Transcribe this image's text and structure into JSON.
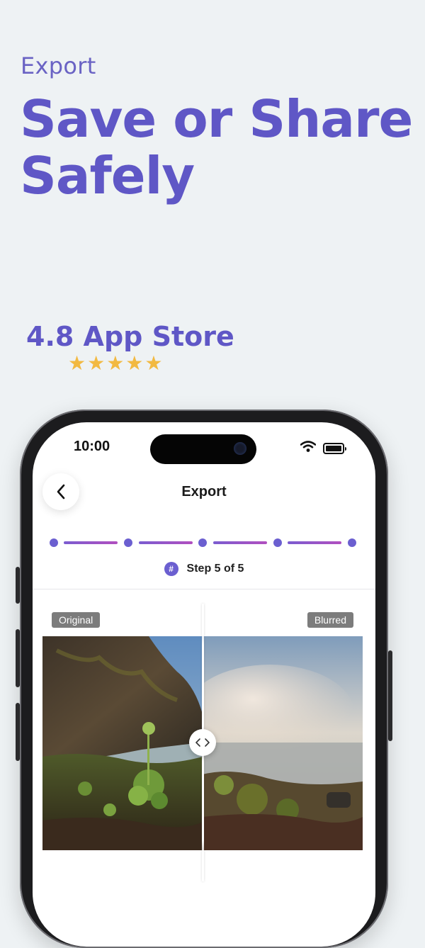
{
  "promo": {
    "eyebrow": "Export",
    "headline": "Save or Share Safely",
    "rating_text": "4.8 App Store",
    "stars": "★★★★★",
    "accent_color": "#5f57c6",
    "star_color": "#f2b941"
  },
  "status_bar": {
    "time": "10:00"
  },
  "nav": {
    "title": "Export",
    "back_icon": "chevron-left-icon"
  },
  "stepper": {
    "total_steps": 5,
    "current_step": 5,
    "badge_symbol": "#",
    "label": "Step 5 of 5"
  },
  "comparison": {
    "left_label": "Original",
    "right_label": "Blurred",
    "divider_position": 0.5,
    "handle_icon": "left-right-arrows-icon"
  }
}
